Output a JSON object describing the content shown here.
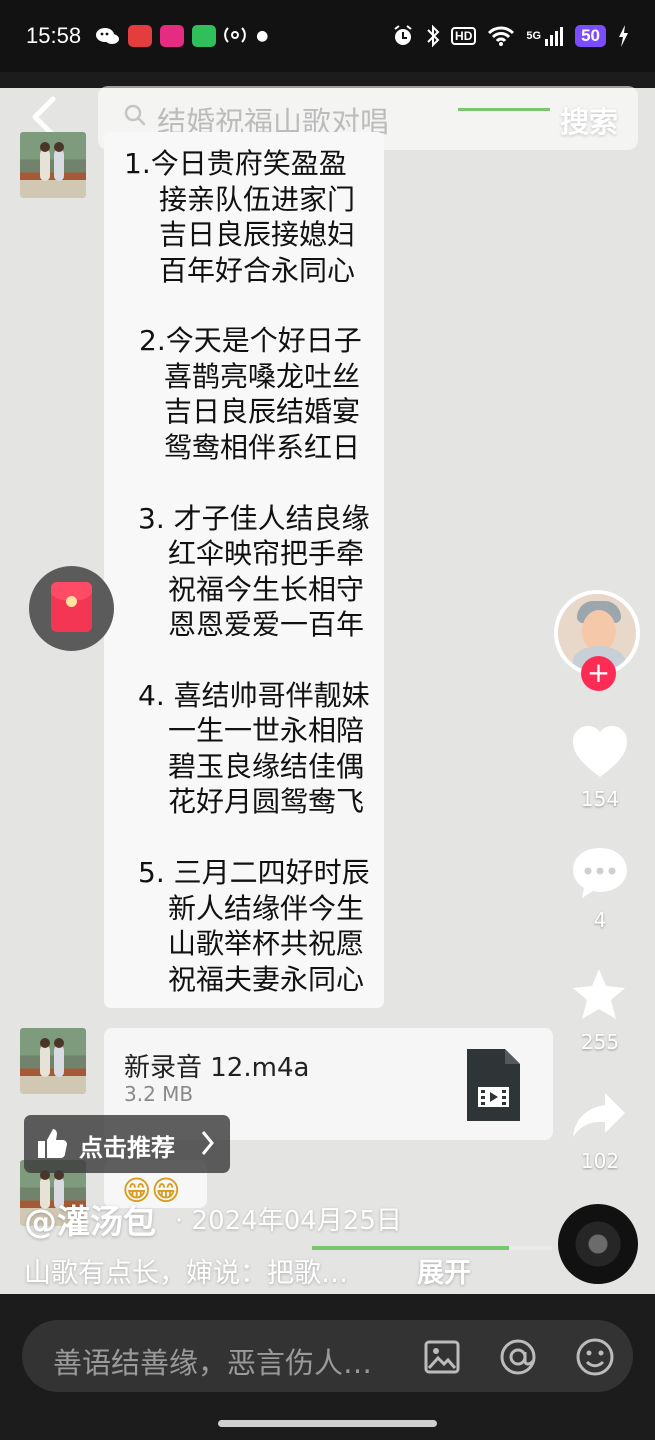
{
  "status_bar": {
    "time": "15:58",
    "network": "5G",
    "battery": "50",
    "hd": "HD"
  },
  "video": {
    "search": {
      "query": "结婚祝福山歌对唱",
      "button": "搜索"
    },
    "chat": {
      "verses": [
        [
          "1.今日贵府笑盈盈",
          "接亲队伍进家门",
          "吉日良辰接媳妇",
          "百年好合永同心"
        ],
        [
          "2.今天是个好日子",
          "喜鹊亮嗓龙吐丝",
          "吉日良辰结婚宴",
          "鸳鸯相伴系红日"
        ],
        [
          "3. 才子佳人结良缘",
          "红伞映帘把手牵",
          "祝福今生长相守",
          "恩恩爱爱一百年"
        ],
        [
          "4. 喜结帅哥伴靓妹",
          "一生一世永相陪",
          "碧玉良缘结佳偶",
          "花好月圆鸳鸯飞"
        ],
        [
          "5. 三月二四好时辰",
          "新人结缘伴今生",
          "山歌举杯共祝愿",
          "祝福夫妻永同心"
        ]
      ],
      "file": {
        "name": "新录音 12.m4a",
        "size": "3.2 MB"
      },
      "emoji": "😁😁"
    },
    "recommend_label": "点击推荐",
    "author": "@灌汤包",
    "date": "· 2024年04月25日",
    "description": "山歌有点长，婶说：把歌…",
    "expand_label": "展开",
    "progress": 0.82
  },
  "actions": {
    "likes": "154",
    "comments": "4",
    "favorites": "255",
    "shares": "102"
  },
  "comment_input": {
    "placeholder": "善语结善缘，恶言伤人…"
  },
  "colors": {
    "accent": "#fe2c55",
    "progress": "#78c76e",
    "battery": "#7c4dff"
  },
  "icons": [
    "back-icon",
    "search-icon",
    "red-envelope-icon",
    "heart-icon",
    "comment-icon",
    "star-icon",
    "share-icon",
    "thumb-up-icon",
    "image-icon",
    "at-icon",
    "emoji-icon",
    "video-file-icon"
  ]
}
